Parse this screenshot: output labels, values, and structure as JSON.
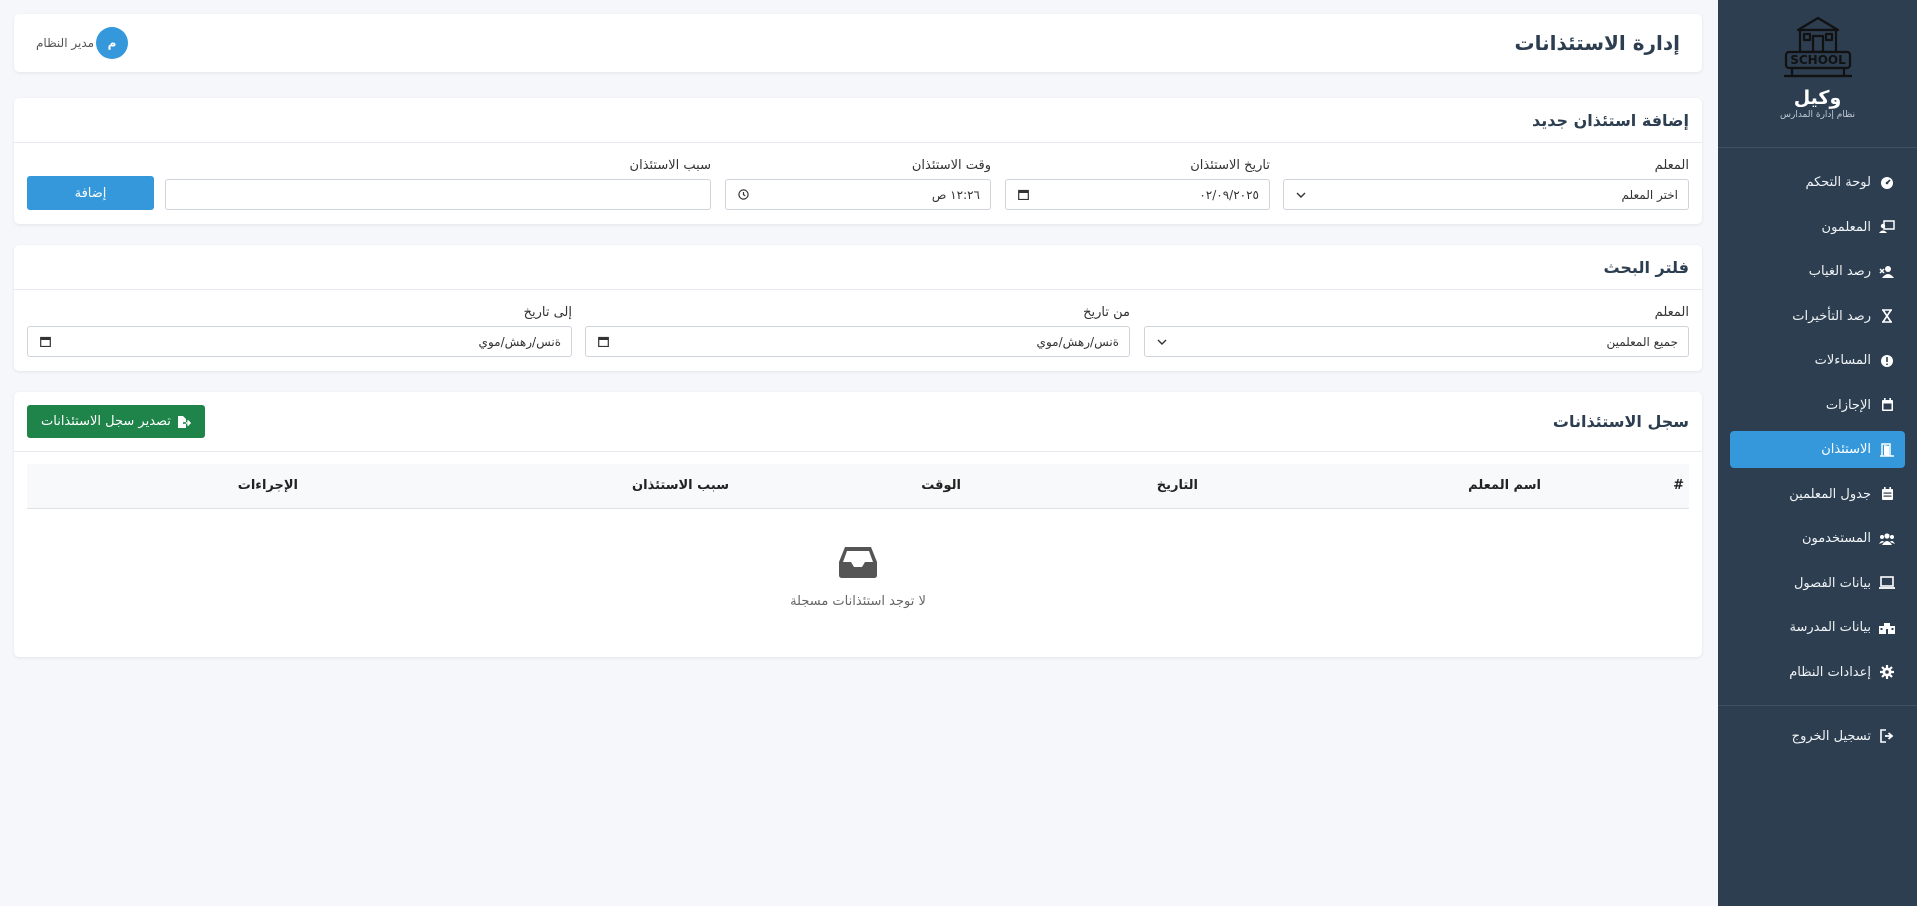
{
  "app": {
    "brand_name": "وكيل",
    "brand_subtitle": "نظام إدارة المدارس",
    "logo_text": "SCHOOL"
  },
  "sidebar": {
    "items": [
      {
        "label": "لوحة التحكم",
        "icon": "dashboard-icon",
        "active": false
      },
      {
        "label": "المعلمون",
        "icon": "teacher-icon",
        "active": false
      },
      {
        "label": "رصد الغياب",
        "icon": "user-x-icon",
        "active": false
      },
      {
        "label": "رصد التأخيرات",
        "icon": "hourglass-icon",
        "active": false
      },
      {
        "label": "المساءلات",
        "icon": "alert-icon",
        "active": false
      },
      {
        "label": "الإجازات",
        "icon": "calendar-icon",
        "active": false
      },
      {
        "label": "الاستئذان",
        "icon": "door-icon",
        "active": true
      },
      {
        "label": "جدول المعلمين",
        "icon": "schedule-icon",
        "active": false
      },
      {
        "label": "المستخدمون",
        "icon": "users-icon",
        "active": false
      },
      {
        "label": "بيانات الفصول",
        "icon": "chalkboard-icon",
        "active": false
      },
      {
        "label": "بيانات المدرسة",
        "icon": "school-icon",
        "active": false
      },
      {
        "label": "إعدادات النظام",
        "icon": "gear-icon",
        "active": false
      }
    ],
    "logout_label": "تسجيل الخروج"
  },
  "header": {
    "title": "إدارة الاستئذانات",
    "user_name": "مدير النظام",
    "avatar_initial": "م"
  },
  "add_form": {
    "title": "إضافة استئذان جديد",
    "teacher_label": "المعلم",
    "teacher_value": "اختر المعلم",
    "date_label": "تاريخ الاستئذان",
    "date_value": "٠٢/٠٩/٢٠٢٥",
    "time_label": "وقت الاستئذان",
    "time_value": "١٢:٢٦ ص",
    "reason_label": "سبب الاستئذان",
    "reason_value": "",
    "submit_label": "إضافة"
  },
  "filter": {
    "title": "فلتر البحث",
    "teacher_label": "المعلم",
    "teacher_value": "جميع المعلمين",
    "from_label": "من تاريخ",
    "from_placeholder": "ةنس/رهش/موي",
    "to_label": "إلى تاريخ",
    "to_placeholder": "ةنس/رهش/موي"
  },
  "log": {
    "title": "سجل الاستئذانات",
    "export_label": "تصدير سجل الاستئذانات",
    "columns": [
      "#",
      "اسم المعلم",
      "التاريخ",
      "الوقت",
      "سبب الاستئذان",
      "الإجراءات"
    ],
    "empty_text": "لا توجد استئذانات مسجلة"
  },
  "colors": {
    "sidebar_bg": "#2c3e50",
    "accent": "#3498db",
    "export_green": "#1e8449"
  }
}
